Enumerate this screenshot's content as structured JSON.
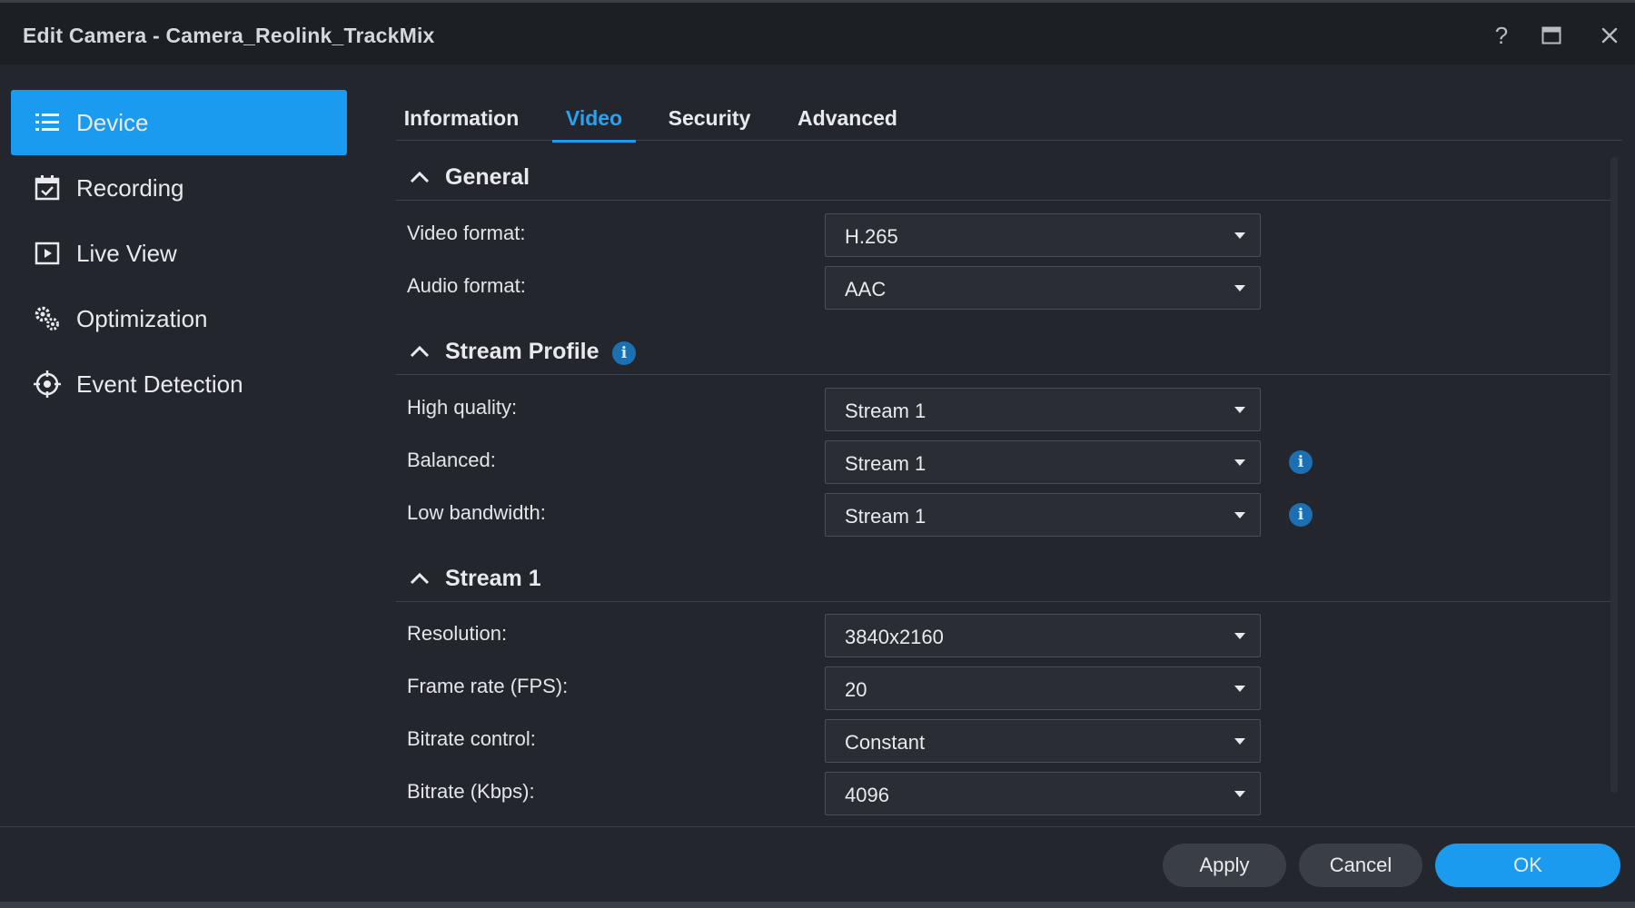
{
  "window": {
    "title": "Edit Camera - Camera_Reolink_TrackMix"
  },
  "titlebar": {
    "help_glyph": "?"
  },
  "sidebar": {
    "items": [
      {
        "label": "Device",
        "icon": "list-icon",
        "active": true
      },
      {
        "label": "Recording",
        "icon": "calendar-check-icon"
      },
      {
        "label": "Live View",
        "icon": "play-screen-icon"
      },
      {
        "label": "Optimization",
        "icon": "gears-icon"
      },
      {
        "label": "Event Detection",
        "icon": "crosshair-icon"
      }
    ]
  },
  "tabs": [
    "Information",
    "Video",
    "Security",
    "Advanced"
  ],
  "active_tab": "Video",
  "sections": {
    "general": {
      "title": "General",
      "fields": [
        {
          "label": "Video format:",
          "value": "H.265"
        },
        {
          "label": "Audio format:",
          "value": "AAC"
        }
      ]
    },
    "stream_profile": {
      "title": "Stream Profile",
      "info_glyph": "i",
      "fields": [
        {
          "label": "High quality:",
          "value": "Stream 1"
        },
        {
          "label": "Balanced:",
          "value": "Stream 1"
        },
        {
          "label": "Low bandwidth:",
          "value": "Stream 1"
        }
      ]
    },
    "stream1": {
      "title": "Stream 1",
      "fields": [
        {
          "label": "Resolution:",
          "value": "3840x2160"
        },
        {
          "label": "Frame rate (FPS):",
          "value": "20"
        },
        {
          "label": "Bitrate control:",
          "value": "Constant"
        },
        {
          "label": "Bitrate (Kbps):",
          "value": "4096"
        }
      ]
    }
  },
  "footer": {
    "apply": "Apply",
    "cancel": "Cancel",
    "ok": "OK"
  },
  "colors": {
    "accent": "#1a9bf0",
    "background": "#23272d",
    "titlebar": "#1c1f23",
    "info": "#1c6fb0"
  }
}
